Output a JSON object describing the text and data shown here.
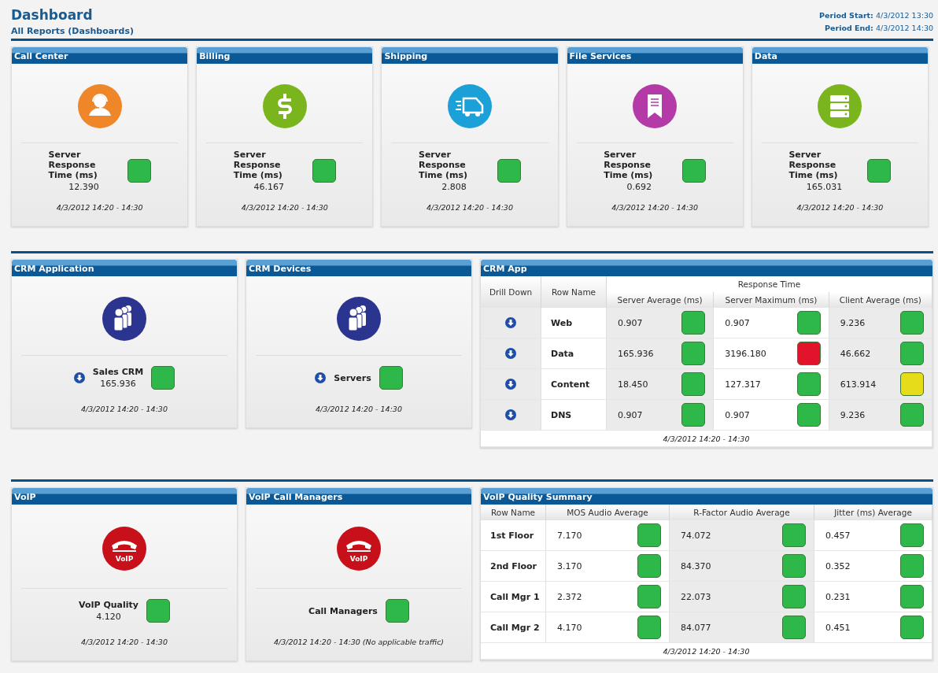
{
  "header": {
    "title": "Dashboard",
    "subtitle": "All Reports (Dashboards)",
    "period_start_label": "Period Start:",
    "period_start": "4/3/2012 13:30",
    "period_end_label": "Period End:",
    "period_end": "4/3/2012 14:30"
  },
  "sections": [
    {
      "panels": [
        {
          "kind": "tile",
          "title": "Call Center",
          "icon": {
            "kind": "headset",
            "color": "#f0862a"
          },
          "metric": {
            "label": "Server Response Time (ms)",
            "value": "12.390",
            "color": "#2fb84a"
          },
          "period": "4/3/2012 14:20 - 14:30"
        },
        {
          "kind": "tile",
          "title": "Billing",
          "icon": {
            "kind": "dollar",
            "color": "#7ab51d"
          },
          "metric": {
            "label": "Server Response Time (ms)",
            "value": "46.167",
            "color": "#2fb84a"
          },
          "period": "4/3/2012 14:20 - 14:30"
        },
        {
          "kind": "tile",
          "title": "Shipping",
          "icon": {
            "kind": "truck",
            "color": "#1ba0d8"
          },
          "metric": {
            "label": "Server Response Time (ms)",
            "value": "2.808",
            "color": "#2fb84a"
          },
          "period": "4/3/2012 14:20 - 14:30"
        },
        {
          "kind": "tile",
          "title": "File Services",
          "icon": {
            "kind": "document",
            "color": "#b43aa8"
          },
          "metric": {
            "label": "Server Response Time (ms)",
            "value": "0.692",
            "color": "#2fb84a"
          },
          "period": "4/3/2012 14:20 - 14:30"
        },
        {
          "kind": "tile",
          "title": "Data",
          "icon": {
            "kind": "server",
            "color": "#7ab51d"
          },
          "metric": {
            "label": "Server Response Time (ms)",
            "value": "165.031",
            "color": "#2fb84a"
          },
          "period": "4/3/2012 14:20 - 14:30"
        }
      ]
    },
    {
      "panels": [
        {
          "kind": "tile",
          "title": "CRM Application",
          "icon": {
            "kind": "people",
            "color": "#2b3590"
          },
          "metric": {
            "drill_down": true,
            "label": "Sales CRM",
            "value": "165.936",
            "color": "#2fb84a"
          },
          "period": "4/3/2012 14:20 - 14:30"
        },
        {
          "kind": "tile",
          "title": "CRM Devices",
          "icon": {
            "kind": "people",
            "color": "#2b3590"
          },
          "metric": {
            "drill_down": true,
            "label": "Servers",
            "color": "#2fb84a"
          },
          "period": "4/3/2012 14:20 - 14:30"
        },
        {
          "kind": "table",
          "title": "CRM App",
          "group_header": "Response Time",
          "columns": [
            "Drill Down",
            "Row Name",
            "Server Average (ms)",
            "Server Maximum (ms)",
            "Client Average (ms)"
          ],
          "rows": [
            {
              "cells": [
                {
                  "kind": "drill",
                  "drill_down": true
                },
                {
                  "kind": "name",
                  "value": "Web"
                },
                {
                  "kind": "metric",
                  "value": "0.907",
                  "color": "#2fb84a"
                },
                {
                  "kind": "metric",
                  "value": "0.907",
                  "color": "#2fb84a"
                },
                {
                  "kind": "metric",
                  "value": "9.236",
                  "color": "#2fb84a"
                }
              ]
            },
            {
              "cells": [
                {
                  "kind": "drill",
                  "drill_down": true
                },
                {
                  "kind": "name",
                  "value": "Data"
                },
                {
                  "kind": "metric",
                  "value": "165.936",
                  "color": "#2fb84a"
                },
                {
                  "kind": "metric",
                  "value": "3196.180",
                  "color": "#e2142b"
                },
                {
                  "kind": "metric",
                  "value": "46.662",
                  "color": "#2fb84a"
                }
              ]
            },
            {
              "cells": [
                {
                  "kind": "drill",
                  "drill_down": true
                },
                {
                  "kind": "name",
                  "value": "Content"
                },
                {
                  "kind": "metric",
                  "value": "18.450",
                  "color": "#2fb84a"
                },
                {
                  "kind": "metric",
                  "value": "127.317",
                  "color": "#2fb84a"
                },
                {
                  "kind": "metric",
                  "value": "613.914",
                  "color": "#e6dc1a"
                }
              ]
            },
            {
              "cells": [
                {
                  "kind": "drill",
                  "drill_down": true
                },
                {
                  "kind": "name",
                  "value": "DNS"
                },
                {
                  "kind": "metric",
                  "value": "0.907",
                  "color": "#2fb84a"
                },
                {
                  "kind": "metric",
                  "value": "0.907",
                  "color": "#2fb84a"
                },
                {
                  "kind": "metric",
                  "value": "9.236",
                  "color": "#2fb84a"
                }
              ]
            }
          ],
          "footer": "4/3/2012 14:20 - 14:30"
        }
      ]
    },
    {
      "panels": [
        {
          "kind": "tile",
          "title": "VoIP",
          "icon": {
            "kind": "phone",
            "color": "#c8101a",
            "text": "VoIP"
          },
          "metric": {
            "label": "VoIP Quality",
            "value": "4.120",
            "color": "#2fb84a"
          },
          "period": "4/3/2012 14:20 - 14:30"
        },
        {
          "kind": "tile",
          "title": "VoIP Call Managers",
          "icon": {
            "kind": "phone",
            "color": "#c8101a",
            "text": "VoIP"
          },
          "metric": {
            "label": "Call Managers",
            "color": "#2fb84a"
          },
          "period": "4/3/2012 14:20 - 14:30 (No applicable traffic)"
        },
        {
          "kind": "table",
          "title": "VoIP Quality Summary",
          "columns": [
            "Row Name",
            "MOS Audio Average",
            "R-Factor Audio Average",
            "Jitter (ms) Average"
          ],
          "rows": [
            {
              "cells": [
                {
                  "kind": "name",
                  "value": "1st Floor"
                },
                {
                  "kind": "metric",
                  "value": "7.170",
                  "color": "#2fb84a"
                },
                {
                  "kind": "metric",
                  "value": "74.072",
                  "color": "#2fb84a"
                },
                {
                  "kind": "metric",
                  "value": "0.457",
                  "color": "#2fb84a"
                }
              ]
            },
            {
              "cells": [
                {
                  "kind": "name",
                  "value": "2nd Floor"
                },
                {
                  "kind": "metric",
                  "value": "3.170",
                  "color": "#2fb84a"
                },
                {
                  "kind": "metric",
                  "value": "84.370",
                  "color": "#2fb84a"
                },
                {
                  "kind": "metric",
                  "value": "0.352",
                  "color": "#2fb84a"
                }
              ]
            },
            {
              "cells": [
                {
                  "kind": "name",
                  "value": "Call Mgr 1"
                },
                {
                  "kind": "metric",
                  "value": "2.372",
                  "color": "#2fb84a"
                },
                {
                  "kind": "metric",
                  "value": "22.073",
                  "color": "#2fb84a"
                },
                {
                  "kind": "metric",
                  "value": "0.231",
                  "color": "#2fb84a"
                }
              ]
            },
            {
              "cells": [
                {
                  "kind": "name",
                  "value": "Call Mgr 2"
                },
                {
                  "kind": "metric",
                  "value": "4.170",
                  "color": "#2fb84a"
                },
                {
                  "kind": "metric",
                  "value": "84.077",
                  "color": "#2fb84a"
                },
                {
                  "kind": "metric",
                  "value": "0.451",
                  "color": "#2fb84a"
                }
              ]
            }
          ],
          "footer": "4/3/2012 14:20 - 14:30"
        }
      ]
    }
  ]
}
